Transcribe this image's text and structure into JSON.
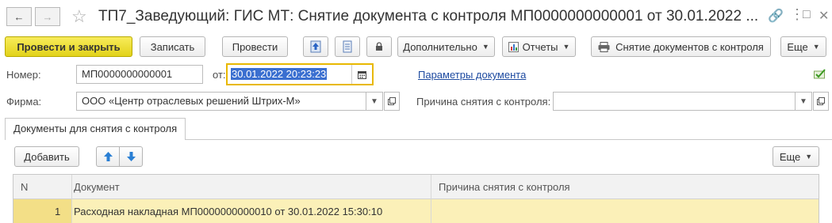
{
  "window": {
    "title": "ТП7_Заведующий: ГИС МТ: Снятие документа с контроля МП0000000000001 от 30.01.2022 ..."
  },
  "toolbar": {
    "post_and_close": "Провести и закрыть",
    "save": "Записать",
    "post": "Провести",
    "more_actions": "Дополнительно",
    "reports": "Отчеты",
    "removal_print": "Снятие документов с контроля",
    "more": "Еще"
  },
  "form": {
    "number_label": "Номер:",
    "number_value": "МП0000000000001",
    "date_label": "от:",
    "date_value": "30.01.2022 20:23:23",
    "params_link": "Параметры документа",
    "firm_label": "Фирма:",
    "firm_value": "ООО «Центр отраслевых решений Штрих-М»",
    "reason_label": "Причина снятия с контроля:",
    "reason_value": ""
  },
  "tab": {
    "label": "Документы для снятия с контроля"
  },
  "table_toolbar": {
    "add": "Добавить",
    "more": "Еще"
  },
  "table": {
    "columns": [
      "N",
      "Документ",
      "Причина снятия с контроля"
    ],
    "rows": [
      {
        "n": "1",
        "document": "Расходная накладная МП0000000000010 от 30.01.2022 15:30:10",
        "reason": ""
      }
    ]
  },
  "colors": {
    "primary_button": "#e9d92a",
    "selected_row": "#fbf0b8",
    "link": "#1d4aa0",
    "date_focus_border": "#e8b800"
  }
}
